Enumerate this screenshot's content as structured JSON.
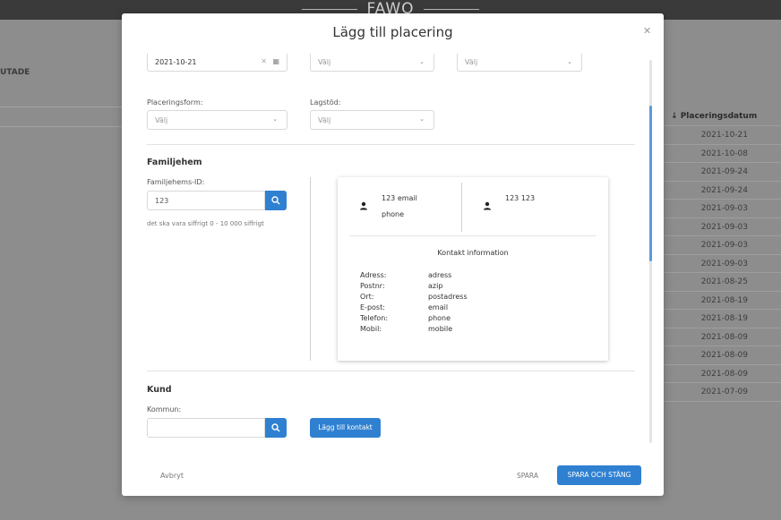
{
  "app": {
    "logo": "FAWO"
  },
  "background": {
    "left_label": "UTADE",
    "table_header": "Placeringsdatum",
    "sort_icon": "arrow-down-icon",
    "dates": [
      "2021-10-21",
      "2021-10-08",
      "2021-09-24",
      "2021-09-24",
      "2021-09-03",
      "2021-09-03",
      "2021-09-03",
      "2021-09-03",
      "2021-08-25",
      "2021-08-19",
      "2021-08-19",
      "2021-08-09",
      "2021-08-09",
      "2021-08-09",
      "2021-07-09"
    ]
  },
  "modal": {
    "title": "Lägg till placering",
    "close_icon": "close-icon",
    "top_row": {
      "date_value": "2021-10-21",
      "select1": "Välj",
      "select2": "Välj"
    },
    "placeringsform": {
      "label": "Placeringsform:",
      "value": "Välj"
    },
    "lagstod": {
      "label": "Lagstöd:",
      "value": "Välj"
    },
    "familjehem": {
      "section_title": "Familjehem",
      "id_label": "Familjehems-ID:",
      "id_value": "123",
      "hint": "det ska vara siffrigt 0 - 10 000 siffrigt"
    },
    "card": {
      "person1_line1": "123 email",
      "person1_line2": "phone",
      "person2_line1": "123 123",
      "contact_title": "Kontakt information",
      "rows": [
        {
          "label": "Adress:",
          "value": "adress"
        },
        {
          "label": "Postnr:",
          "value": "azip"
        },
        {
          "label": "Ort:",
          "value": "postadress"
        },
        {
          "label": "E-post:",
          "value": "email"
        },
        {
          "label": "Telefon:",
          "value": "phone"
        },
        {
          "label": "Mobil:",
          "value": "mobile"
        }
      ]
    },
    "kund": {
      "section_title": "Kund",
      "kommun_label": "Kommun:",
      "kommun_value": "",
      "add_contact": "Lägg till kontakt"
    },
    "footer": {
      "cancel": "Avbryt",
      "save": "SPARA",
      "save_close": "SPARA OCH STÄNG"
    },
    "accent_color": "#2f80d1"
  }
}
